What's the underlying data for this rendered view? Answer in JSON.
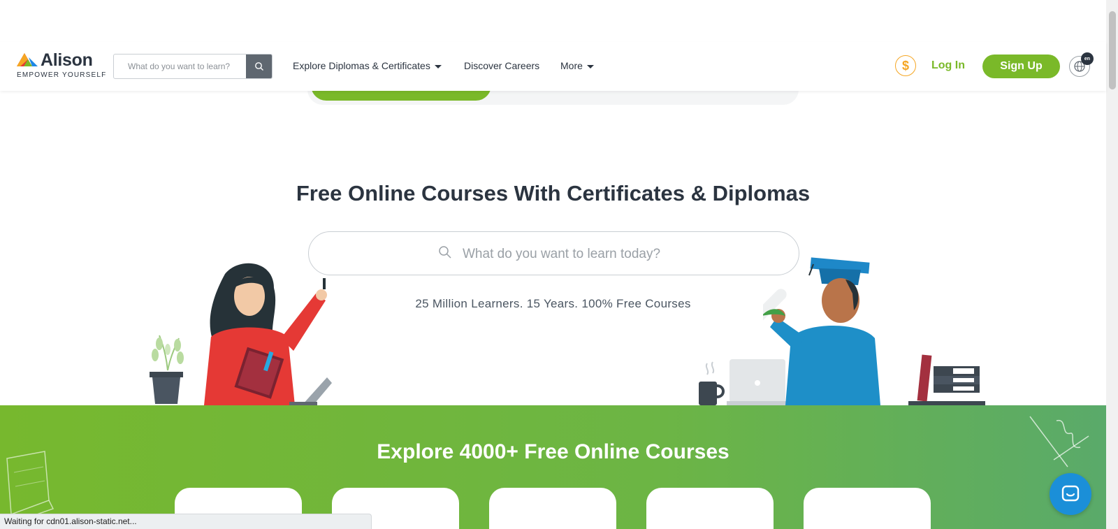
{
  "header": {
    "logo_word": "Alison",
    "logo_tagline": "EMPOWER YOURSELF",
    "search_placeholder": "What do you want to learn?",
    "nav": {
      "explore": "Explore Diplomas & Certificates",
      "careers": "Discover Careers",
      "more": "More"
    },
    "currency_symbol": "$",
    "login": "Log In",
    "signup": "Sign Up",
    "language": "en"
  },
  "hero": {
    "title": "Free Online Courses With Certificates & Diplomas",
    "search_placeholder": "What do you want to learn today?",
    "tagline": "25 Million Learners. 15 Years. 100% Free Courses"
  },
  "explore": {
    "title": "Explore 4000+ Free Online Courses"
  },
  "status_bar": "Waiting for cdn01.alison-static.net...",
  "colors": {
    "brand_green": "#7ab929",
    "dark_text": "#2b3440",
    "currency_orange": "#f5a623",
    "chat_blue": "#1b8fd8"
  },
  "icons": [
    "search-icon",
    "chevron-down-icon",
    "dollar-icon",
    "globe-icon",
    "chat-icon"
  ]
}
